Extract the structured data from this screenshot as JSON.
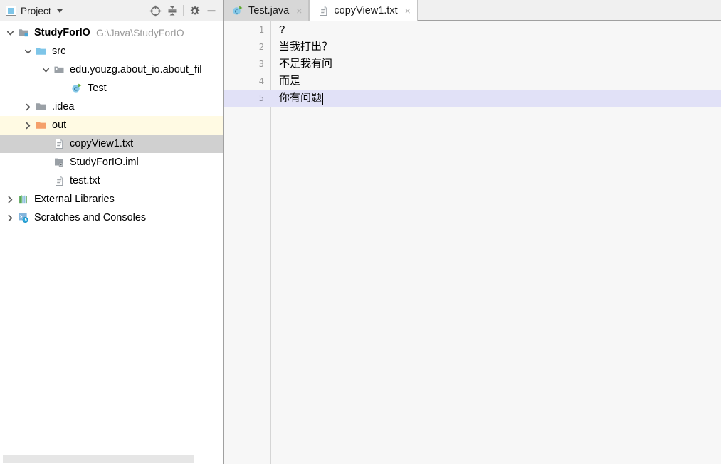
{
  "project_panel": {
    "header": {
      "title": "Project",
      "dropdown_icon": "chevron-down-icon",
      "buttons": [
        {
          "name": "locate-file-button",
          "icon": "crosshair-target-icon",
          "tooltip": "Select Opened File"
        },
        {
          "name": "collapse-all-button",
          "icon": "collapse-all-icon",
          "tooltip": "Collapse All"
        },
        {
          "name": "settings-button",
          "icon": "gear-icon",
          "tooltip": "Settings"
        },
        {
          "name": "hide-button",
          "icon": "minimize-icon",
          "tooltip": "Hide"
        }
      ]
    },
    "tree": [
      {
        "label": "StudyForIO",
        "sublabel": "G:\\Java\\StudyForIO",
        "icon": "module-folder-icon",
        "indent": 0,
        "twisty": "expanded",
        "bold": true,
        "state": "normal"
      },
      {
        "label": "src",
        "sublabel": "",
        "icon": "source-root-folder-icon",
        "indent": 1,
        "twisty": "expanded",
        "bold": false,
        "state": "normal"
      },
      {
        "label": "edu.youzg.about_io.about_fil",
        "sublabel": "",
        "icon": "package-icon",
        "indent": 2,
        "twisty": "expanded",
        "bold": false,
        "state": "normal"
      },
      {
        "label": "Test",
        "sublabel": "",
        "icon": "java-class-runnable-icon",
        "indent": 3,
        "twisty": "none",
        "bold": false,
        "state": "normal"
      },
      {
        "label": ".idea",
        "sublabel": "",
        "icon": "folder-icon",
        "indent": 1,
        "twisty": "collapsed",
        "bold": false,
        "state": "normal"
      },
      {
        "label": "out",
        "sublabel": "",
        "icon": "excluded-folder-icon",
        "indent": 1,
        "twisty": "collapsed",
        "bold": false,
        "state": "excluded"
      },
      {
        "label": "copyView1.txt",
        "sublabel": "",
        "icon": "text-file-icon",
        "indent": 2,
        "twisty": "none",
        "bold": false,
        "state": "selected"
      },
      {
        "label": "StudyForIO.iml",
        "sublabel": "",
        "icon": "iml-file-icon",
        "indent": 2,
        "twisty": "none",
        "bold": false,
        "state": "normal"
      },
      {
        "label": "test.txt",
        "sublabel": "",
        "icon": "text-file-icon",
        "indent": 2,
        "twisty": "none",
        "bold": false,
        "state": "normal"
      },
      {
        "label": "External Libraries",
        "sublabel": "",
        "icon": "libraries-icon",
        "indent": 0,
        "twisty": "collapsed",
        "bold": false,
        "state": "normal"
      },
      {
        "label": "Scratches and Consoles",
        "sublabel": "",
        "icon": "scratches-icon",
        "indent": 0,
        "twisty": "collapsed",
        "bold": false,
        "state": "normal"
      }
    ]
  },
  "editor": {
    "tabs": [
      {
        "label": "Test.java",
        "icon": "java-class-runnable-icon",
        "active": false,
        "close_glyph": "×"
      },
      {
        "label": "copyView1.txt",
        "icon": "text-file-icon",
        "active": true,
        "close_glyph": "×"
      }
    ],
    "lines": [
      {
        "number": "1",
        "text": "?",
        "current": false
      },
      {
        "number": "2",
        "text": "当我打出？",
        "current": false
      },
      {
        "number": "3",
        "text": "不是我有问",
        "current": false
      },
      {
        "number": "4",
        "text": "而是",
        "current": false
      },
      {
        "number": "5",
        "text": "你有问题",
        "current": true
      }
    ]
  },
  "colors": {
    "panel_bg": "#f0f0f0",
    "tree_bg": "#ffffff",
    "selection_bg": "#d0d0d0",
    "excluded_bg": "#fffae3",
    "editor_bg": "#f7f7f7",
    "current_line_bg": "#e1e1f7",
    "active_tab_bg": "#ffffff",
    "inactive_tab_bg": "#d7d7d7",
    "source_root": "#7ec5e8",
    "excluded_folder": "#f5a06a",
    "gutter_text": "#999999"
  }
}
